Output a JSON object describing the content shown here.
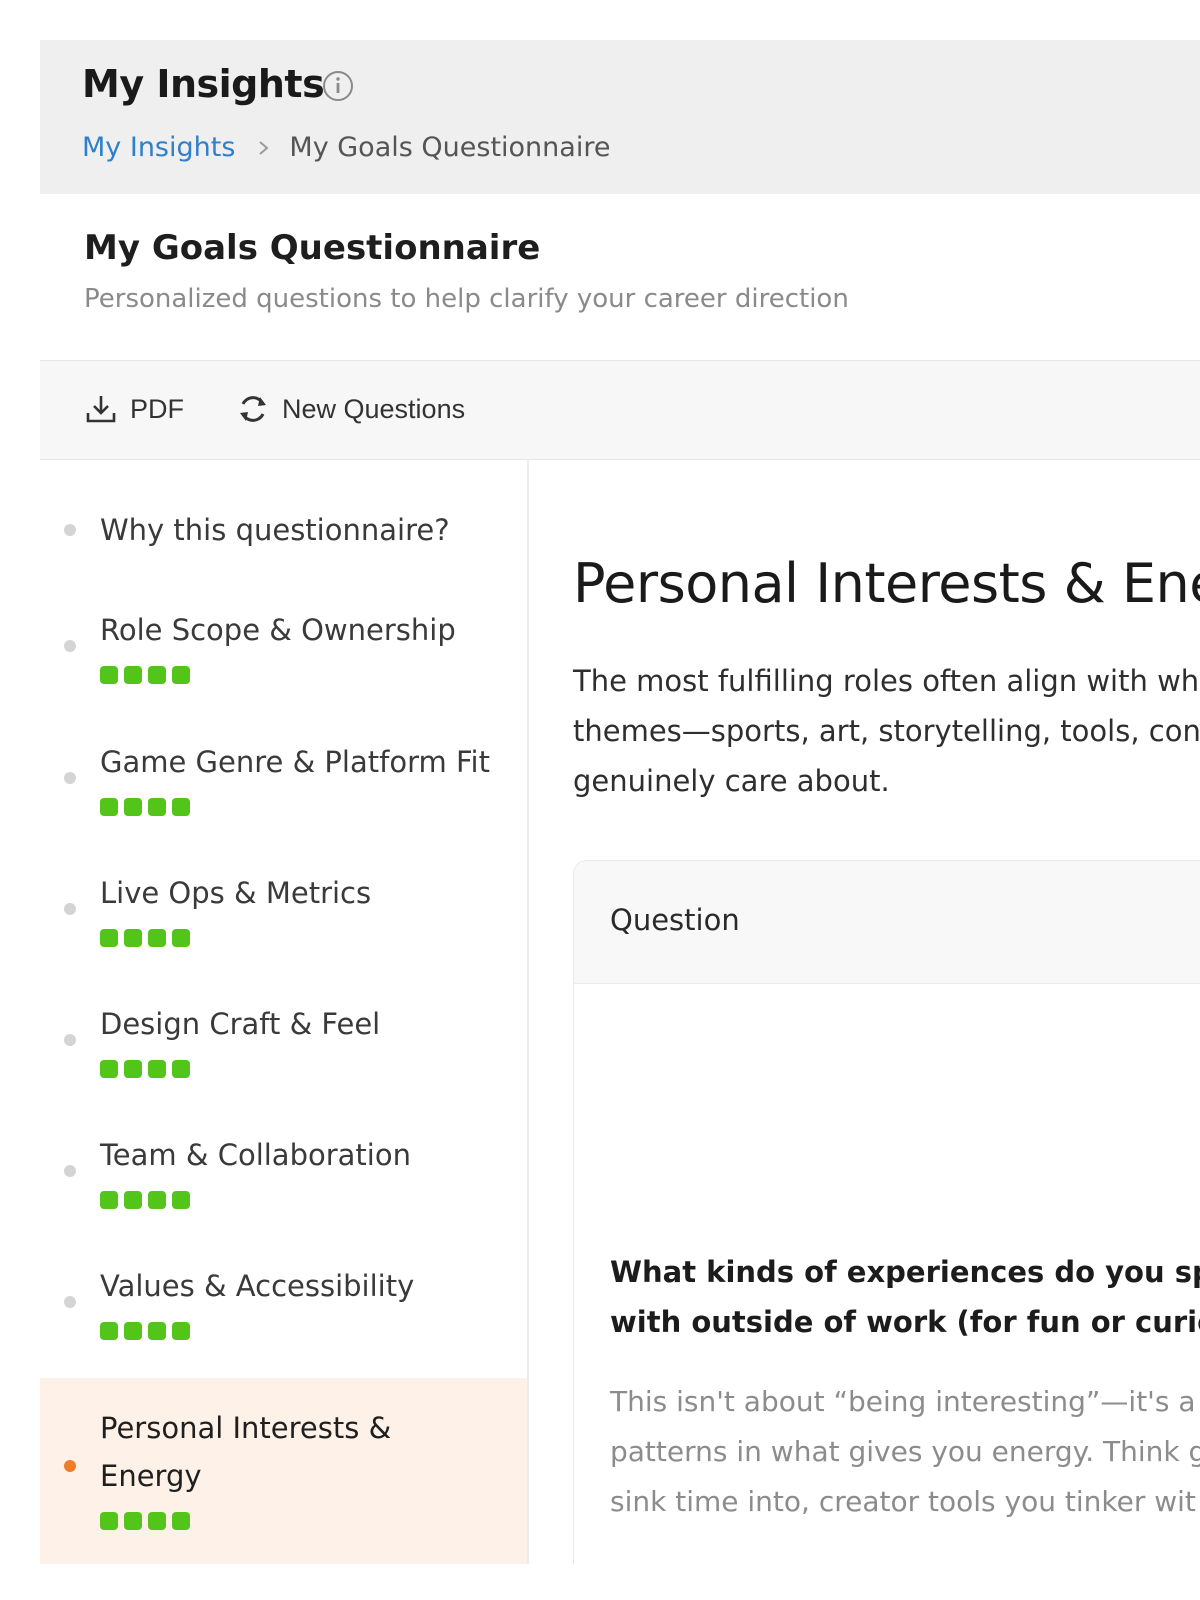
{
  "header": {
    "title": "My Insights",
    "info_icon": "info-circle-icon",
    "breadcrumb": {
      "link": "My Insights",
      "separator_icon": "chevron-right-icon",
      "current": "My Goals Questionnaire"
    }
  },
  "section": {
    "title": "My Goals Questionnaire",
    "subtitle": "Personalized questions to help clarify your career direction"
  },
  "toolbar": {
    "pdf_label": "PDF",
    "pdf_icon": "download-icon",
    "new_questions_label": "New Questions",
    "new_questions_icon": "refresh-icon"
  },
  "sidebar": {
    "items": [
      {
        "label": "Why this questionnaire?",
        "progress": null,
        "active": false
      },
      {
        "label": "Role Scope & Ownership",
        "progress": 4,
        "active": false
      },
      {
        "label": "Game Genre & Platform Fit",
        "progress": 4,
        "active": false
      },
      {
        "label": "Live Ops & Metrics",
        "progress": 4,
        "active": false
      },
      {
        "label": "Design Craft & Feel",
        "progress": 4,
        "active": false
      },
      {
        "label": "Team & Collaboration",
        "progress": 4,
        "active": false
      },
      {
        "label": "Values & Accessibility",
        "progress": 4,
        "active": false
      },
      {
        "label": "Personal Interests & Energy",
        "progress": 4,
        "active": true
      }
    ],
    "active_color": "#f07c2a",
    "progress_color": "#52c41a"
  },
  "main": {
    "heading": "Personal Interests & Ener",
    "description": "The most fulfilling roles often align with wh\nthemes—sports, art, storytelling, tools, con\ngenuinely care about.",
    "card": {
      "header_label": "Question",
      "question": "What kinds of experiences do you spen\nwith outside of work (for fun or curiosi",
      "hint": "This isn't about “being interesting”—it's a\npatterns in what gives you energy. Think g\nsink time into, creator tools you tinker wit"
    }
  },
  "colors": {
    "link": "#2f7fc9",
    "header_bg": "#efefef",
    "active_bg": "#fdf1e8"
  }
}
